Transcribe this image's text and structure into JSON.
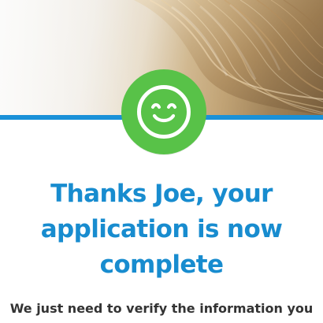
{
  "header": {
    "image_alt": "Scenic background photo"
  },
  "confirmation": {
    "headline_line_1": "Thanks Joe, your",
    "headline_line_2": "application is now",
    "headline_line_3": "complete",
    "subtext": "We just need to verify the information you"
  },
  "colors": {
    "accent_blue": "#1a91d8",
    "success_green": "#58c248",
    "headline_blue": "#188ccf",
    "body_text": "#333333"
  },
  "icons": {
    "success": "smile-icon"
  }
}
